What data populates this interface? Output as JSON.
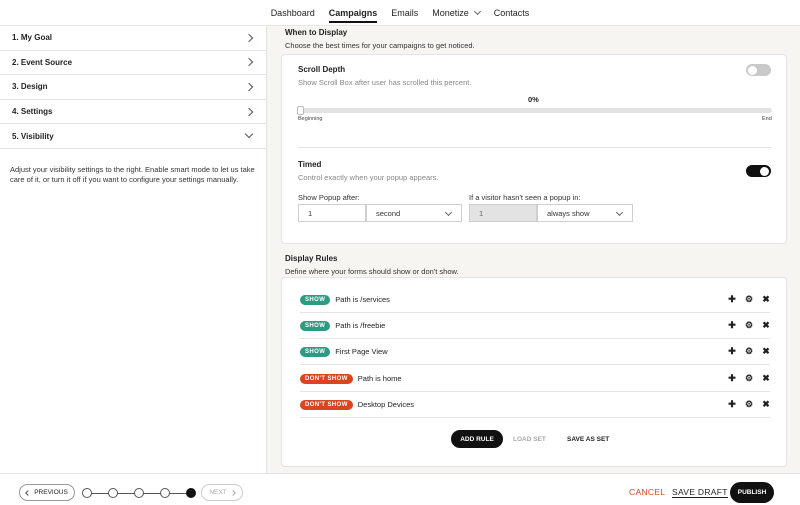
{
  "nav": {
    "items": [
      {
        "label": "Dashboard"
      },
      {
        "label": "Campaigns"
      },
      {
        "label": "Emails"
      },
      {
        "label": "Monetize"
      },
      {
        "label": "Contacts"
      }
    ]
  },
  "sidebar": {
    "steps": [
      {
        "label": "1. My Goal"
      },
      {
        "label": "2. Event Source"
      },
      {
        "label": "3. Design"
      },
      {
        "label": "4. Settings"
      },
      {
        "label": "5. Visibility"
      }
    ],
    "help_text": "Adjust your visibility settings to the right. Enable smart mode to let us take care of it, or turn it off if you want to configure your settings manually."
  },
  "when": {
    "title": "When to Display",
    "subtitle": "Choose the best times for your campaigns to get noticed.",
    "scroll": {
      "title": "Scroll Depth",
      "desc": "Show Scroll Box after user has scrolled this percent.",
      "value": "0%",
      "percent": 0,
      "min_label": "Beginning",
      "max_label": "End",
      "enabled": false
    },
    "timed": {
      "title": "Timed",
      "desc": "Control exactly when your popup appears.",
      "enabled": true,
      "show_after_label": "Show Popup after:",
      "show_after_value": "1",
      "show_after_unit": "second",
      "visitor_label": "If a visitor hasn't seen a popup in:",
      "visitor_value": "1",
      "visitor_unit": "always show"
    }
  },
  "rules": {
    "title": "Display Rules",
    "subtitle": "Define where your forms should show or don't show.",
    "items": [
      {
        "badge": "SHOW",
        "text": "Path is /services"
      },
      {
        "badge": "SHOW",
        "text": "Path is /freebie"
      },
      {
        "badge": "SHOW",
        "text": "First Page View"
      },
      {
        "badge": "DON'T SHOW",
        "text": "Path is home"
      },
      {
        "badge": "DON'T SHOW",
        "text": "Desktop Devices"
      }
    ],
    "add_rule": "ADD RULE",
    "load_set": "LOAD SET",
    "save_as_set": "SAVE AS SET"
  },
  "footer": {
    "previous": "PREVIOUS",
    "next": "NEXT",
    "cancel": "CANCEL",
    "save_draft": "SAVE DRAFT",
    "publish": "PUBLISH",
    "total_steps": 5,
    "current_step": 5
  },
  "colors": {
    "show_badge": "#2e9a82",
    "dont_show_badge": "#d9451f",
    "primary": "#111111",
    "cancel": "#d9451f"
  }
}
